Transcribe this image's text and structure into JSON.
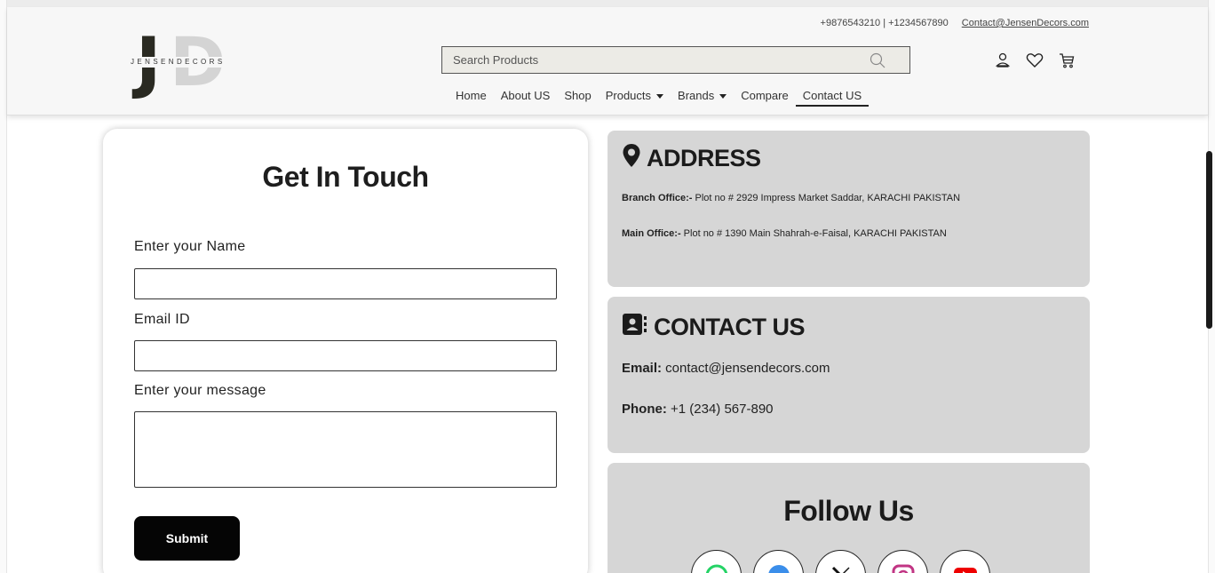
{
  "header": {
    "logo_text": "JENSENDECORS",
    "phones": "+9876543210 | +1234567890",
    "email": "Contact@JensenDecors.com",
    "search_placeholder": "Search Products"
  },
  "nav": {
    "items": [
      {
        "label": "Home"
      },
      {
        "label": "About US"
      },
      {
        "label": "Shop"
      },
      {
        "label": "Products"
      },
      {
        "label": "Brands"
      },
      {
        "label": "Compare"
      },
      {
        "label": "Contact US"
      }
    ]
  },
  "form": {
    "title": "Get In Touch",
    "name_label": "Enter your Name",
    "name_value": "",
    "email_label": "Email ID",
    "email_value": "",
    "message_label": "Enter your message",
    "message_value": "",
    "submit_label": "Submit"
  },
  "address": {
    "heading": "ADDRESS",
    "branch_label": "Branch Office:-",
    "branch_text": " Plot no # 2929 Impress Market Saddar, KARACHI PAKISTAN",
    "main_label": "Main Office:-",
    "main_text": " Plot no # 1390 Main Shahrah-e-Faisal, KARACHI PAKISTAN"
  },
  "contact": {
    "heading": "CONTACT US",
    "email_label": "Email:",
    "email_value": " contact@jensendecors.com",
    "phone_label": "Phone:",
    "phone_value": " +1 (234) 567-890"
  },
  "follow": {
    "title": "Follow Us",
    "socials": [
      "whatsapp-icon",
      "facebook-icon",
      "x-icon",
      "instagram-icon",
      "youtube-icon"
    ]
  },
  "colors": {
    "card_bg": "#d6d6d6",
    "button_bg": "#050505",
    "header_bg": "#f7f7f7"
  }
}
